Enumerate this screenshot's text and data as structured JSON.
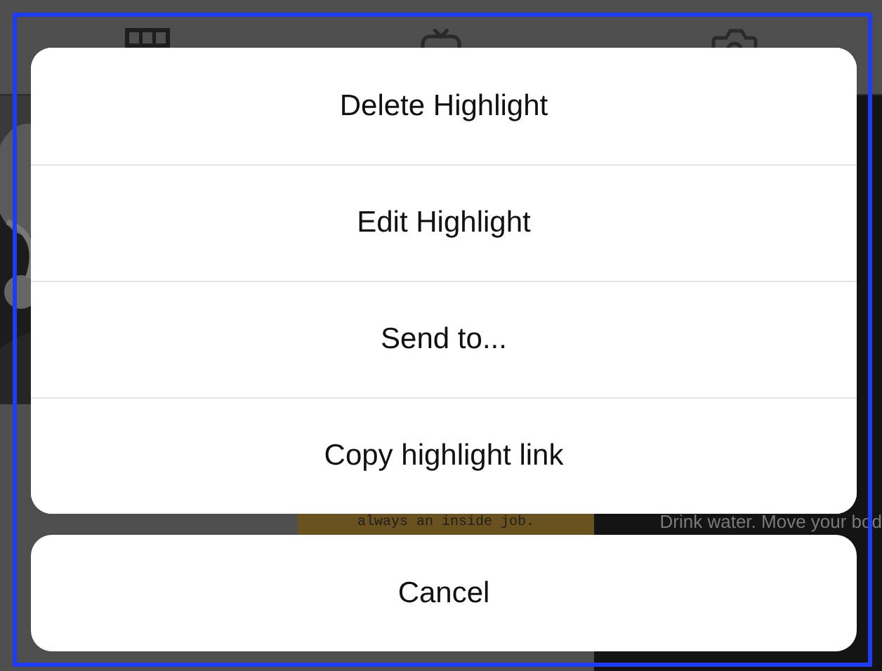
{
  "background": {
    "middle_caption": "always an inside job.",
    "right_lines": [
      "Drink water. Move your bod"
    ]
  },
  "action_sheet": {
    "actions": [
      {
        "label": "Delete Highlight"
      },
      {
        "label": "Edit Highlight"
      },
      {
        "label": "Send to..."
      },
      {
        "label": "Copy highlight link"
      }
    ],
    "cancel": "Cancel"
  }
}
